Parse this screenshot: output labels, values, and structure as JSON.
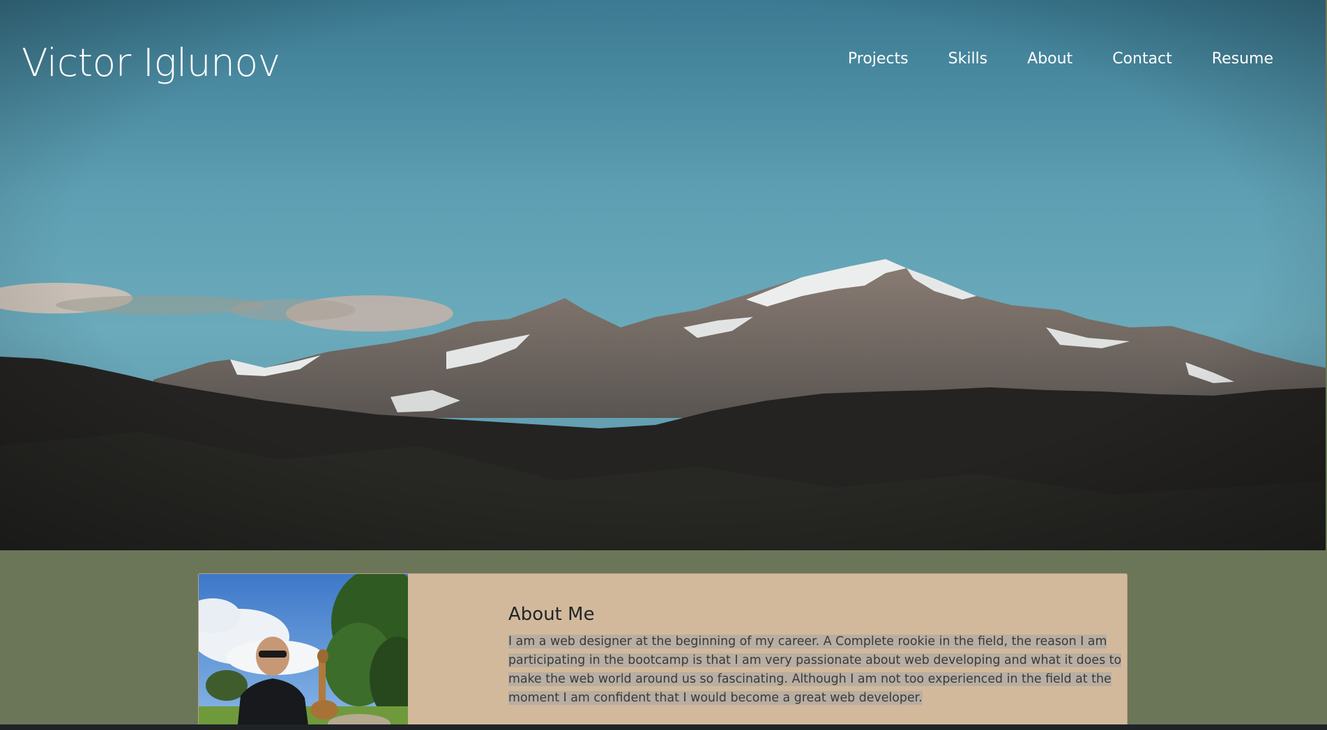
{
  "header": {
    "brand": "Victor Iglunov",
    "nav": [
      "Projects",
      "Skills",
      "About",
      "Contact",
      "Resume"
    ]
  },
  "about": {
    "title": "About Me",
    "text": "I am a web designer at the beginning of my career. A Complete rookie in the field, the reason I am participating in the bootcamp is that I am very passionate about web developing and what it does to make the web world around us so fascinating. Although I am not too experienced in the field at the moment I am confident that I would become a great web developer."
  },
  "colors": {
    "section_bg": "#6b7659",
    "card_bg": "#d3b99c",
    "sky": "#5a9cb0",
    "text_highlight": "#b8aea2"
  }
}
